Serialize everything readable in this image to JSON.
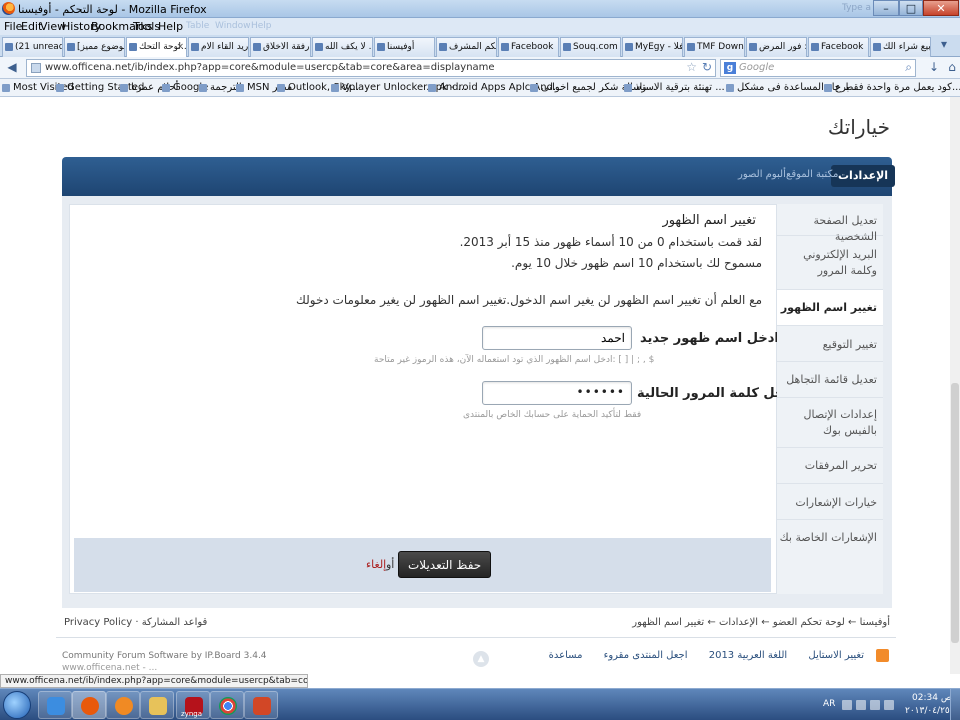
{
  "window": {
    "title": "لوحة التحكم - أوفيسنا - Mozilla Firefox",
    "search_ghost": "Type a question for help"
  },
  "menu": [
    "File",
    "Edit",
    "View",
    "History",
    "Bookmarks",
    "Tools",
    "Help"
  ],
  "menu_ghost": [
    "Table",
    "Window",
    "Help"
  ],
  "tabs": [
    "(21 unread) - ...",
    "[موضوع مميز] ...",
    "لوحة التحك...",
    "اريد القاء الام...",
    "رفقة الاخلاق ...",
    "لا يكف الله ...",
    "أوفيسنا",
    "لوحة تحكم المشرف",
    "Facebook",
    "Souq.com Eg...",
    "MyEgy - افلا...",
    "TMF Downlo...",
    "فور المرض : ...",
    "Facebook",
    "بيع شراء الك ..."
  ],
  "url": "www.officena.net/ib/index.php?app=core&module=usercp&tab=core&area=displayname",
  "search_placeholder": "Google",
  "bookmarks": [
    "Most Visited",
    "Getting Started",
    "أحلام عمرنا",
    "Google",
    "الترجمة",
    "MSN مصر",
    "Outlook, Sky...",
    "Vplayer Unlocker.apk - ...",
    "Android Apps Aplc And...",
    "رسالة شكر لجميع اخوانى...",
    "تهنئة بترقية الاستاذ ...",
    "برجاء المساعدة فى مشكل...",
    "كود يعمل مرة واحدة فقط ع..."
  ],
  "page": {
    "title": "خياراتك",
    "nav_tabs": [
      "الإعدادات",
      "مكتبة الموقع",
      "ألبوم الصور"
    ],
    "section_title": "تغيير اسم الظهور",
    "line1": "لقد قمت باستخدام 0 من 10 أسماء ظهور منذ 15 أبر 2013.",
    "line2": "مسموح لك باستخدام 10 اسم ظهور خلال 10 يوم.",
    "notice": "مع العلم أن تغيير اسم الظهور لن يغير اسم الدخول.تغيير اسم الظهور لن يغير معلومات دخولك",
    "new_name_label": "ادخل اسم ظهور جديد",
    "new_name_value": "احمد",
    "new_name_hint": "ادخل اسم الظهور الذي تود استعماله الآن، هذه الرموز غير متاحة: [ ] | ; , $",
    "password_label": "ادخل كلمة المرور الحالية",
    "password_value": "••••••",
    "password_hint": "فقط لتأكيد الحماية على حسابك الخاص بالمنتدى",
    "save_label": "حفظ التعديلات",
    "or_text": "أو",
    "cancel_label": "إلغاء",
    "side_menu": [
      "تعديل الصفحة الشخصية",
      "البريد الإلكتروني وكلمة المرور",
      "تغيير اسم الظهور",
      "تغيير التوقيع",
      "تعديل قائمة التجاهل",
      "إعدادات الإتصال بالفيس بوك",
      "تحرير المرفقات",
      "خيارات الإشعارات",
      "الإشعارات الخاصة بك"
    ],
    "breadcrumb": [
      "أوفيسنا",
      "لوحة تحكم العضو",
      "الإعدادات",
      "تغيير اسم الظهور"
    ],
    "footer_left": "Privacy Policy · قواعد المشاركة",
    "ipb_credit": "Community Forum Software by IP.Board 3.4.4",
    "domain_sub": "www.officena.net - ...",
    "footer_links": [
      "تغيير الاستايل",
      "اللغة العربية 2013",
      "اجعل المنتدى مقروء",
      "مساعدة"
    ]
  },
  "status_url": "www.officena.net/ib/index.php?app=core&module=usercp&tab=core&area=displayname",
  "taskbar": {
    "lang": "AR",
    "time": "02:34 ص",
    "date": "٢٠١٣/٠٤/٢٥",
    "zynga": "zynga"
  },
  "colors": {
    "nav_blue": "#1e4572",
    "cancel_red": "#ab1e1e",
    "save_dark": "#242424"
  }
}
